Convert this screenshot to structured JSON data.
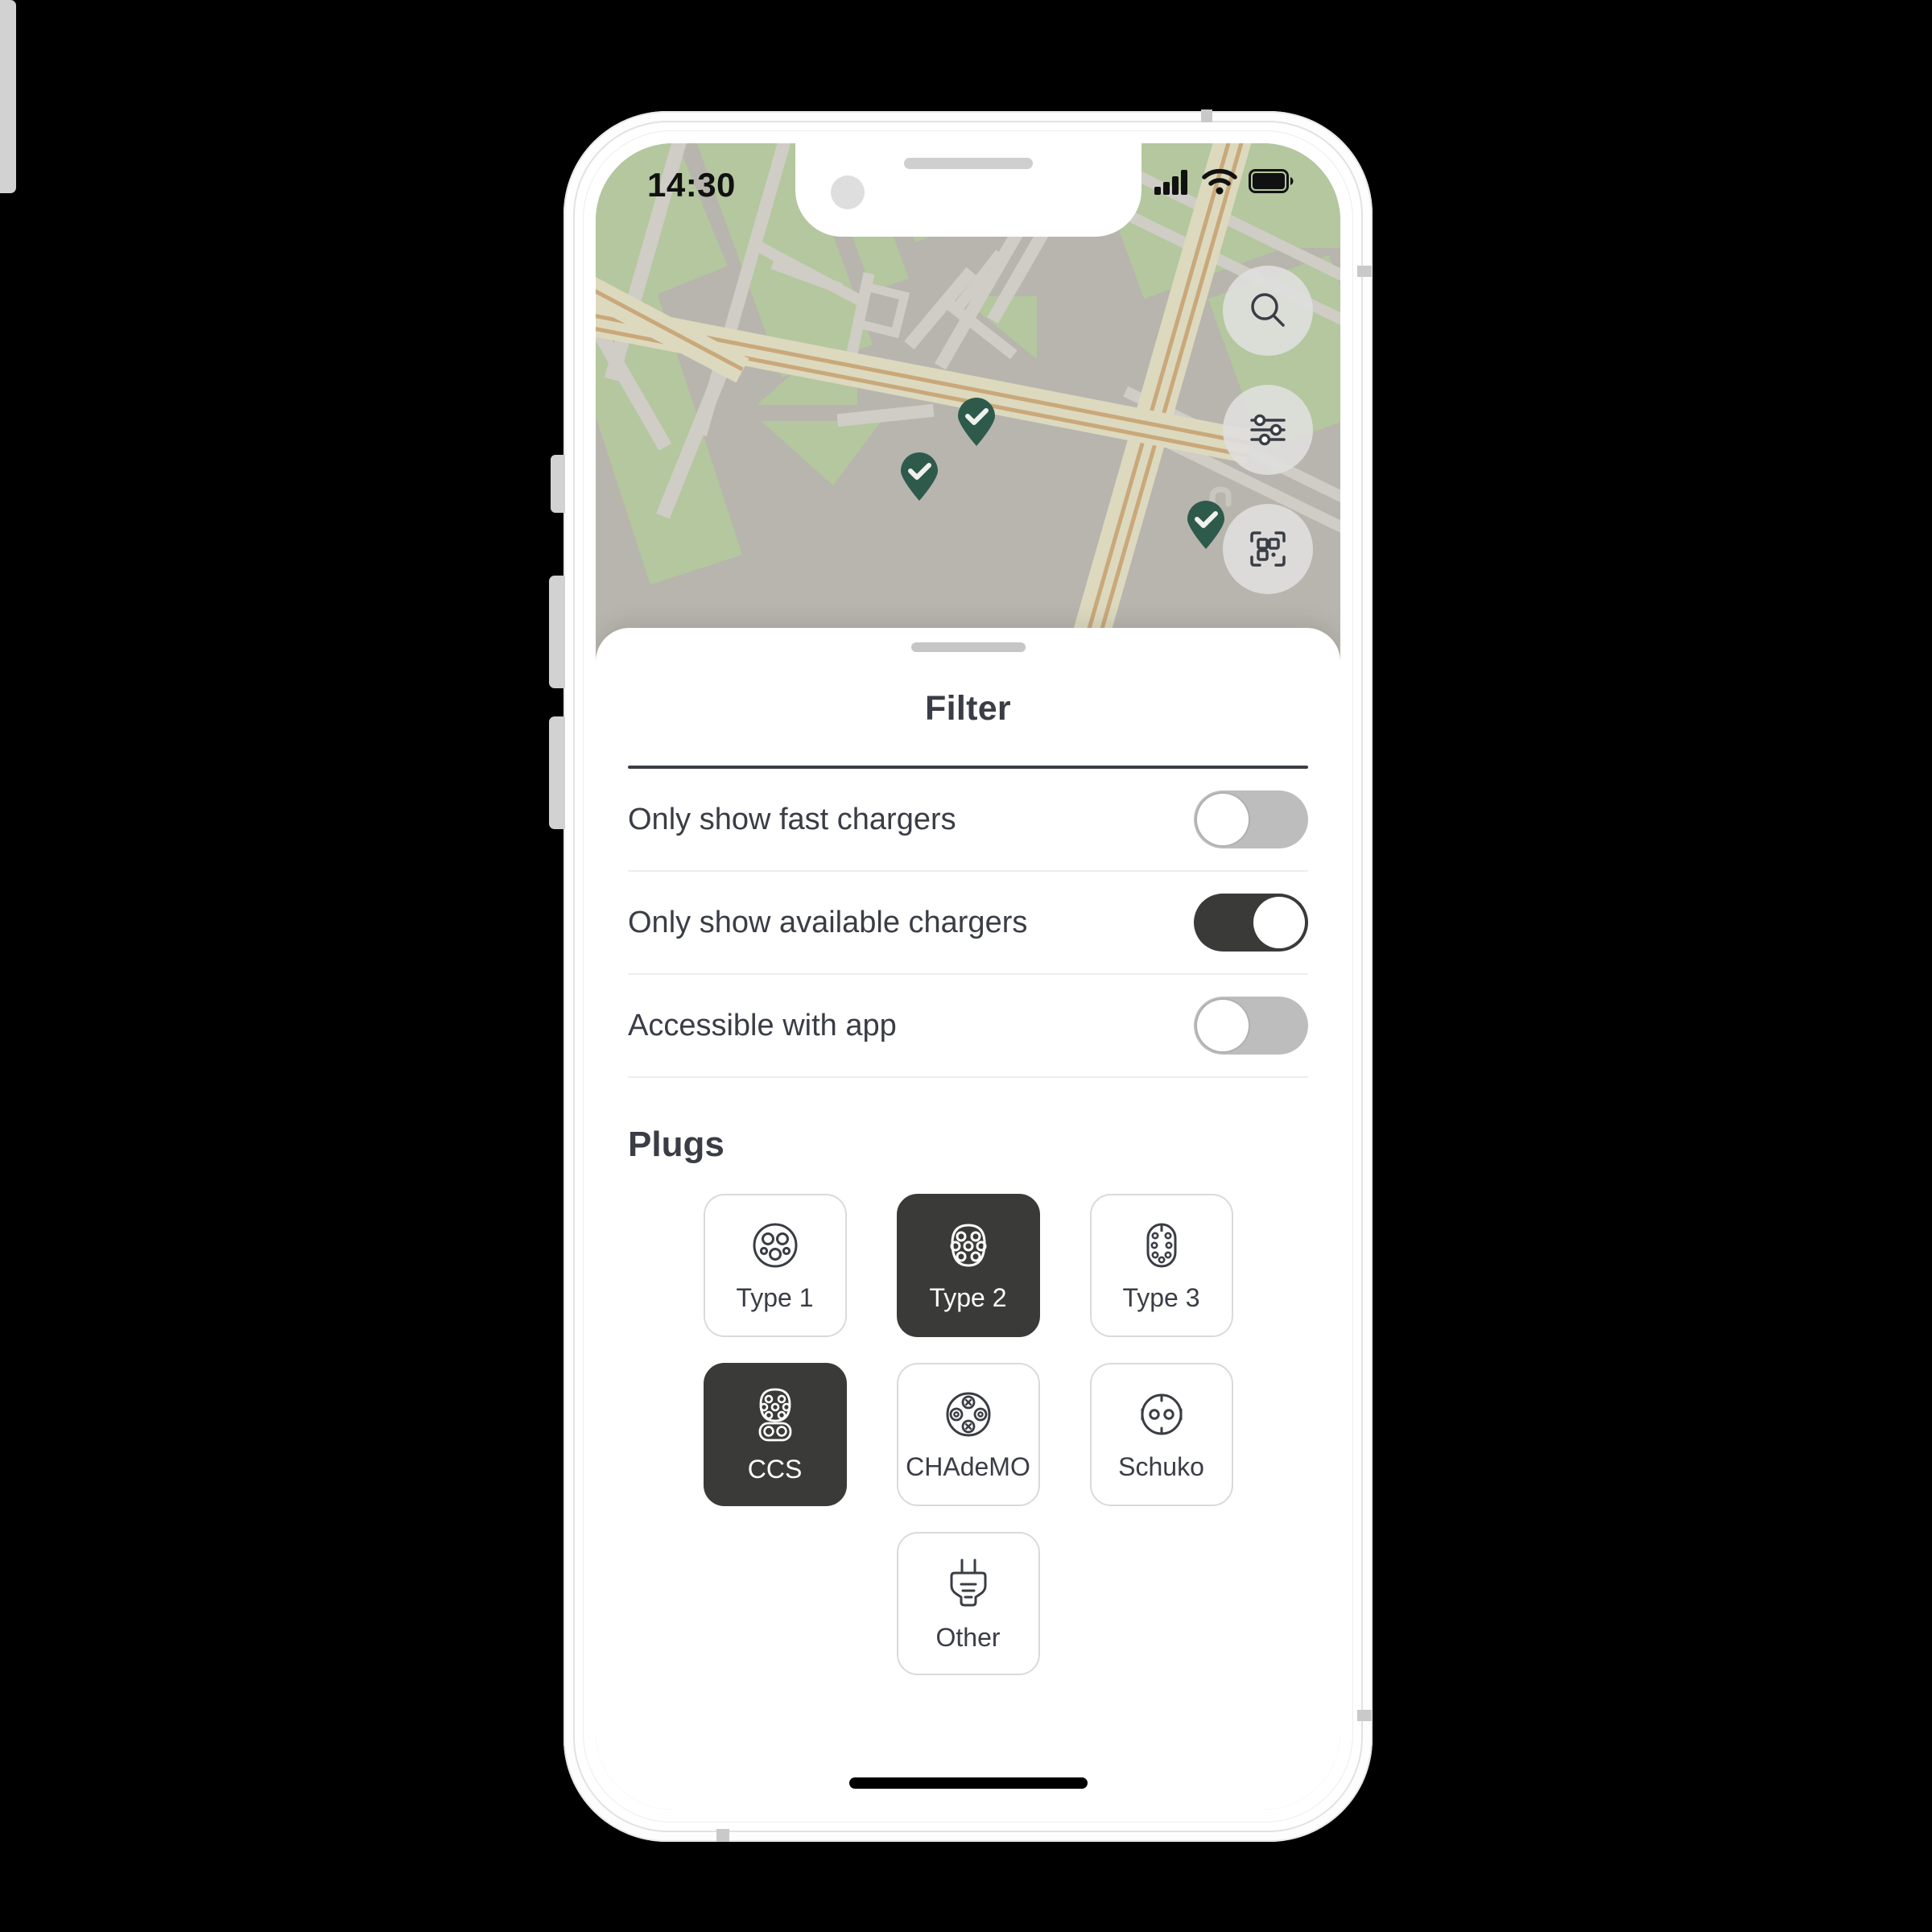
{
  "status_bar": {
    "time": "14:30",
    "cellular_icon": "signal-bars-icon",
    "wifi_icon": "wifi-icon",
    "battery_icon": "battery-full-icon"
  },
  "map": {
    "markers": [
      {
        "name": "charger-marker-1",
        "icon": "check-icon"
      },
      {
        "name": "charger-marker-2",
        "icon": "check-icon"
      },
      {
        "name": "charger-marker-3",
        "icon": "check-icon"
      }
    ],
    "buttons": [
      {
        "name": "search-button",
        "icon": "search-icon"
      },
      {
        "name": "filter-button",
        "icon": "sliders-icon"
      },
      {
        "name": "scan-button",
        "icon": "qr-scan-icon"
      }
    ]
  },
  "sheet": {
    "title": "Filter",
    "toggles": [
      {
        "label": "Only show fast chargers",
        "state": "off"
      },
      {
        "label": "Only show available chargers",
        "state": "on"
      },
      {
        "label": "Accessible with app",
        "state": "off"
      }
    ],
    "plugs_heading": "Plugs",
    "plugs": [
      {
        "label": "Type 1",
        "icon": "plug-type1-icon",
        "selected": false
      },
      {
        "label": "Type 2",
        "icon": "plug-type2-icon",
        "selected": true
      },
      {
        "label": "Type 3",
        "icon": "plug-type3-icon",
        "selected": false
      },
      {
        "label": "CCS",
        "icon": "plug-ccs-icon",
        "selected": true
      },
      {
        "label": "CHAdeMO",
        "icon": "plug-chademo-icon",
        "selected": false
      },
      {
        "label": "Schuko",
        "icon": "plug-schuko-icon",
        "selected": false
      },
      {
        "label": "Other",
        "icon": "plug-other-icon",
        "selected": false
      }
    ]
  },
  "colors": {
    "accent_dark": "#3A3A38",
    "marker_green": "#2E5A4C",
    "text": "#3A3D45",
    "toggle_off": "#BDBDBD",
    "map_background": "#B7B5AD",
    "map_green": "#B4C79E"
  }
}
